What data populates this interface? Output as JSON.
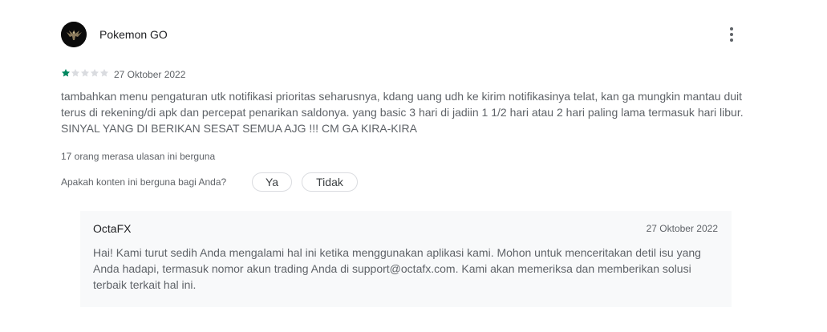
{
  "review": {
    "author": "Pokemon GO",
    "avatar_icon": "dragon-avatar-icon",
    "more_icon": "more-vert-icon",
    "rating": 1,
    "rating_max": 5,
    "star_filled_color": "#01875f",
    "star_empty_color": "#dadce0",
    "date": "27 Oktober 2022",
    "text": "tambahkan menu pengaturan utk notifikasi prioritas seharusnya, kdang uang udh ke kirim notifikasinya telat, kan ga mungkin mantau duit terus di rekening/di apk dan percepat penarikan saldonya. yang basic 3 hari di jadiin 1 1/2 hari atau 2 hari paling lama termasuk hari libur. SINYAL YANG DI BERIKAN SESAT SEMUA AJG !!! CM GA KIRA-KIRA",
    "helpful_count": "17 orang merasa ulasan ini berguna",
    "helpful_question": "Apakah konten ini berguna bagi Anda?",
    "yes_label": "Ya",
    "no_label": "Tidak"
  },
  "reply": {
    "author": "OctaFX",
    "date": "27 Oktober 2022",
    "text": "Hai! Kami turut sedih Anda mengalami hal ini ketika menggunakan aplikasi kami. Mohon untuk menceritakan detil isu yang Anda hadapi, termasuk nomor akun trading Anda di support@octafx.com. Kami akan memeriksa dan memberikan solusi terbaik terkait hal ini."
  }
}
